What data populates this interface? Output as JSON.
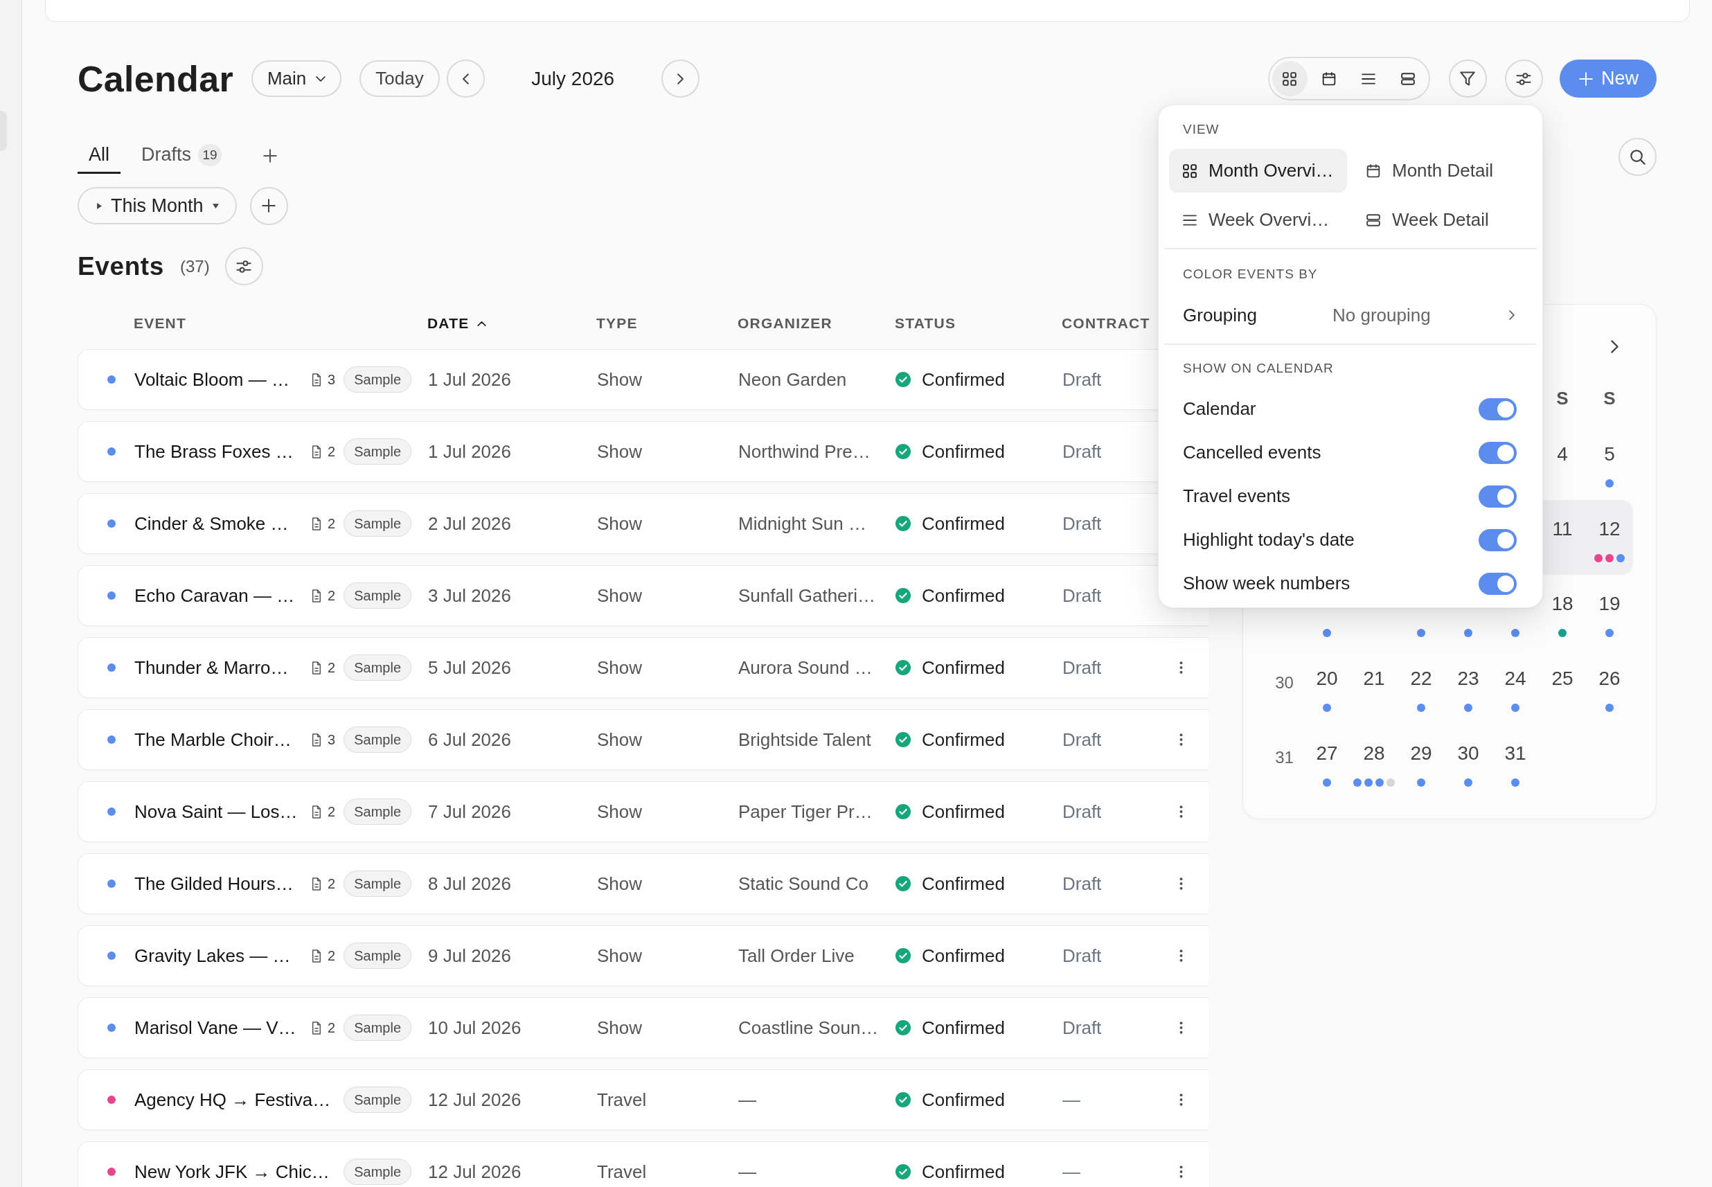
{
  "header": {
    "title": "Calendar",
    "calendar_select": "Main",
    "today_button": "Today",
    "period": "July 2026",
    "view_switcher": [
      {
        "selected": true
      },
      {
        "selected": false
      },
      {
        "selected": false
      },
      {
        "selected": false
      }
    ],
    "new_button": "New"
  },
  "view_menu": {
    "view_label": "VIEW",
    "views": [
      {
        "label": "Month Overvi…",
        "selected": true
      },
      {
        "label": "Month Detail",
        "selected": false
      },
      {
        "label": "Week Overvi…",
        "selected": false
      },
      {
        "label": "Week Detail",
        "selected": false
      }
    ],
    "color_label": "COLOR EVENTS BY",
    "grouping": {
      "label": "Grouping",
      "value": "No grouping"
    },
    "show_label": "SHOW ON CALENDAR",
    "toggles": [
      {
        "label": "Calendar",
        "on": true
      },
      {
        "label": "Cancelled events",
        "on": true
      },
      {
        "label": "Travel events",
        "on": true
      },
      {
        "label": "Highlight today's date",
        "on": true
      },
      {
        "label": "Show week numbers",
        "on": true
      }
    ]
  },
  "tabs": [
    {
      "label": "All",
      "selected": true
    },
    {
      "label": "Drafts",
      "count": "19",
      "selected": false
    }
  ],
  "filters": [
    {
      "label": "This Month"
    }
  ],
  "events": {
    "title": "Events",
    "count": "(37)",
    "columns": [
      {
        "label": "EVENT",
        "sorted": false
      },
      {
        "label": "DATE",
        "sorted": true
      },
      {
        "label": "TYPE",
        "sorted": false
      },
      {
        "label": "ORGANIZER",
        "sorted": false
      },
      {
        "label": "STATUS",
        "sorted": false
      },
      {
        "label": "CONTRACT",
        "sorted": false
      }
    ],
    "rows": [
      {
        "name": "Voltaic Bloom — …",
        "color": "#5b8def",
        "files": "3",
        "tag": "Sample",
        "date": "1 Jul 2026",
        "type": "Show",
        "organizer": "Neon Garden",
        "status": "Confirmed",
        "contract": "Draft"
      },
      {
        "name": "The Brass Foxes …",
        "color": "#5b8def",
        "files": "2",
        "tag": "Sample",
        "date": "1 Jul 2026",
        "type": "Show",
        "organizer": "Northwind Pre…",
        "status": "Confirmed",
        "contract": "Draft"
      },
      {
        "name": "Cinder & Smoke …",
        "color": "#5b8def",
        "files": "2",
        "tag": "Sample",
        "date": "2 Jul 2026",
        "type": "Show",
        "organizer": "Midnight Sun …",
        "status": "Confirmed",
        "contract": "Draft"
      },
      {
        "name": "Echo Caravan — …",
        "color": "#5b8def",
        "files": "2",
        "tag": "Sample",
        "date": "3 Jul 2026",
        "type": "Show",
        "organizer": "Sunfall Gatheri…",
        "status": "Confirmed",
        "contract": "Draft"
      },
      {
        "name": "Thunder & Marro…",
        "color": "#5b8def",
        "files": "2",
        "tag": "Sample",
        "date": "5 Jul 2026",
        "type": "Show",
        "organizer": "Aurora Sound …",
        "status": "Confirmed",
        "contract": "Draft",
        "menu_button": true
      },
      {
        "name": "The Marble Choir…",
        "color": "#5b8def",
        "files": "3",
        "tag": "Sample",
        "date": "6 Jul 2026",
        "type": "Show",
        "organizer": "Brightside Talent",
        "status": "Confirmed",
        "contract": "Draft",
        "menu_button": true
      },
      {
        "name": "Nova Saint — Los…",
        "color": "#5b8def",
        "files": "2",
        "tag": "Sample",
        "date": "7 Jul 2026",
        "type": "Show",
        "organizer": "Paper Tiger Pr…",
        "status": "Confirmed",
        "contract": "Draft",
        "menu_button": true
      },
      {
        "name": "The Gilded Hours…",
        "color": "#5b8def",
        "files": "2",
        "tag": "Sample",
        "date": "8 Jul 2026",
        "type": "Show",
        "organizer": "Static Sound Co",
        "status": "Confirmed",
        "contract": "Draft",
        "menu_button": true
      },
      {
        "name": "Gravity Lakes — …",
        "color": "#5b8def",
        "files": "2",
        "tag": "Sample",
        "date": "9 Jul 2026",
        "type": "Show",
        "organizer": "Tall Order Live",
        "status": "Confirmed",
        "contract": "Draft",
        "menu_button": true
      },
      {
        "name": "Marisol Vane — V…",
        "color": "#5b8def",
        "files": "2",
        "tag": "Sample",
        "date": "10 Jul 2026",
        "type": "Show",
        "organizer": "Coastline Soun…",
        "status": "Confirmed",
        "contract": "Draft",
        "menu_button": true
      },
      {
        "name": "Agency HQ → Festiva…",
        "color": "#e8458f",
        "tag": "Sample",
        "date": "12 Jul 2026",
        "type": "Travel",
        "organizer": "—",
        "status": "Confirmed",
        "contract": "—",
        "menu_button": true
      },
      {
        "name": "New York JFK → Chic…",
        "color": "#e8458f",
        "tag": "Sample",
        "date": "12 Jul 2026",
        "type": "Travel",
        "organizer": "—",
        "status": "Confirmed",
        "contract": "—",
        "menu_button": true
      }
    ]
  },
  "mini_calendar": {
    "day_headers": [
      "S",
      "S"
    ],
    "weeks": [
      {
        "current": false,
        "days": [
          {
            "kind": "covered"
          },
          {
            "kind": "covered"
          },
          {
            "kind": "covered"
          },
          {
            "kind": "covered"
          },
          {
            "kind": "covered"
          },
          {
            "kind": "day",
            "date": "4"
          },
          {
            "kind": "day",
            "date": "5",
            "dots": [
              {
                "color": "#5b8def"
              }
            ]
          }
        ]
      },
      {
        "current": true,
        "days": [
          {
            "kind": "covered"
          },
          {
            "kind": "covered"
          },
          {
            "kind": "covered"
          },
          {
            "kind": "covered"
          },
          {
            "kind": "covered"
          },
          {
            "kind": "day",
            "date": "11"
          },
          {
            "kind": "day",
            "date": "12",
            "dots": [
              {
                "color": "#e8458f"
              },
              {
                "color": "#e8458f"
              },
              {
                "color": "#5b8def"
              }
            ]
          }
        ]
      },
      {
        "current": false,
        "days": [
          {
            "kind": "day",
            "dots": [
              {
                "color": "#5b8def"
              }
            ]
          },
          {
            "kind": "covered"
          },
          {
            "kind": "day",
            "dots": [
              {
                "color": "#5b8def"
              }
            ]
          },
          {
            "kind": "day",
            "dots": [
              {
                "color": "#5b8def"
              }
            ]
          },
          {
            "kind": "day",
            "dots": [
              {
                "color": "#5b8def"
              }
            ]
          },
          {
            "kind": "day",
            "date": "18",
            "dots": [
              {
                "color": "#1a9e8c"
              }
            ]
          },
          {
            "kind": "day",
            "date": "19",
            "dots": [
              {
                "color": "#5b8def"
              }
            ]
          }
        ]
      },
      {
        "current": false,
        "number": "30",
        "days": [
          {
            "kind": "day",
            "date": "20",
            "dots": [
              {
                "color": "#5b8def"
              }
            ]
          },
          {
            "kind": "day",
            "date": "21"
          },
          {
            "kind": "day",
            "date": "22",
            "dots": [
              {
                "color": "#5b8def"
              }
            ]
          },
          {
            "kind": "day",
            "date": "23",
            "dots": [
              {
                "color": "#5b8def"
              }
            ]
          },
          {
            "kind": "day",
            "date": "24",
            "dots": [
              {
                "color": "#5b8def"
              }
            ]
          },
          {
            "kind": "day",
            "date": "25"
          },
          {
            "kind": "day",
            "date": "26",
            "dots": [
              {
                "color": "#5b8def"
              }
            ]
          }
        ]
      },
      {
        "current": false,
        "number": "31",
        "days": [
          {
            "kind": "day",
            "date": "27",
            "dots": [
              {
                "color": "#5b8def"
              }
            ]
          },
          {
            "kind": "day",
            "date": "28",
            "dots": [
              {
                "color": "#5b8def"
              },
              {
                "color": "#5b8def"
              },
              {
                "color": "#5b8def"
              },
              {
                "color": "#d6d6d6"
              }
            ]
          },
          {
            "kind": "day",
            "date": "29",
            "dots": [
              {
                "color": "#5b8def"
              }
            ]
          },
          {
            "kind": "day",
            "date": "30",
            "dots": [
              {
                "color": "#5b8def"
              }
            ]
          },
          {
            "kind": "day",
            "date": "31",
            "dots": [
              {
                "color": "#5b8def"
              }
            ]
          }
        ]
      }
    ]
  }
}
